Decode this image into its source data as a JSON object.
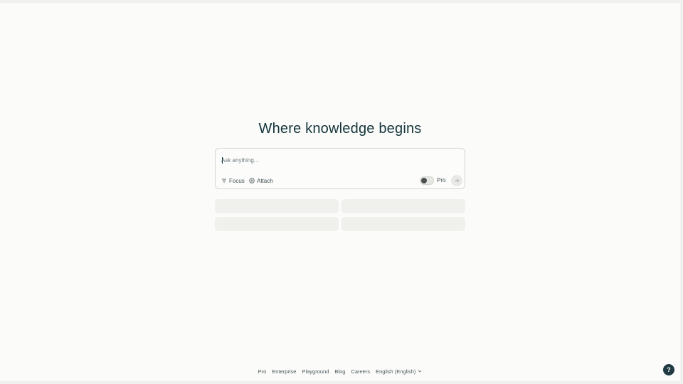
{
  "hero": {
    "title": "Where knowledge begins"
  },
  "ask": {
    "placeholder": "Ask anything...",
    "focus_label": "Focus",
    "attach_label": "Attach",
    "pro_label": "Pro",
    "pro_toggle_on": false
  },
  "suggestions": [
    "",
    "",
    "",
    ""
  ],
  "footer": {
    "links": [
      "Pro",
      "Enterprise",
      "Playground",
      "Blog",
      "Careers"
    ],
    "language": "English (English)"
  },
  "help": {
    "label": "?"
  },
  "colors": {
    "background": "#fbfbf9",
    "text": "#13343b",
    "help_button": "#1f3a42"
  }
}
